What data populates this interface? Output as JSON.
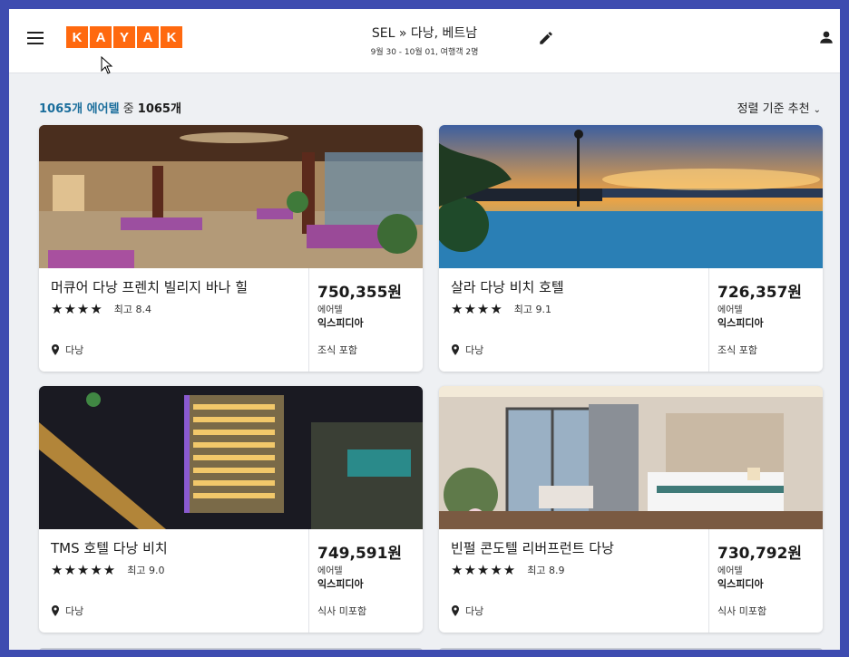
{
  "header": {
    "logo_letters": [
      "K",
      "A",
      "Y",
      "A",
      "K"
    ],
    "route": "SEL » 다낭, 베트남",
    "details": "9월 30 - 10월 01, 여행객 2명"
  },
  "results": {
    "count_shown": "1065개 에어텔",
    "connector": " 중 ",
    "count_total": "1065개",
    "sort_label": "정렬 기준 추천"
  },
  "hotels": [
    {
      "name": "머큐어 다낭 프렌치 빌리지 바나 힐",
      "stars": "★★★★",
      "score": "최고 8.4",
      "location": "다낭",
      "price": "750,355원",
      "type": "에어텔",
      "provider": "익스피디아",
      "meal": "조식 포함"
    },
    {
      "name": "살라 다낭 비치 호텔",
      "stars": "★★★★",
      "score": "최고 9.1",
      "location": "다낭",
      "price": "726,357원",
      "type": "에어텔",
      "provider": "익스피디아",
      "meal": "조식 포함"
    },
    {
      "name": "TMS 호텔 다낭 비치",
      "stars": "★★★★★",
      "score": "최고 9.0",
      "location": "다낭",
      "price": "749,591원",
      "type": "에어텔",
      "provider": "익스피디아",
      "meal": "식사 미포함"
    },
    {
      "name": "빈펄 콘도텔 리버프런트 다낭",
      "stars": "★★★★★",
      "score": "최고 8.9",
      "location": "다낭",
      "price": "730,792원",
      "type": "에어텔",
      "provider": "익스피디아",
      "meal": "식사 미포함"
    }
  ],
  "colors": {
    "brand": "#ff690f",
    "count_highlight": "#1b6e9c",
    "frame": "#3e4cb0"
  }
}
